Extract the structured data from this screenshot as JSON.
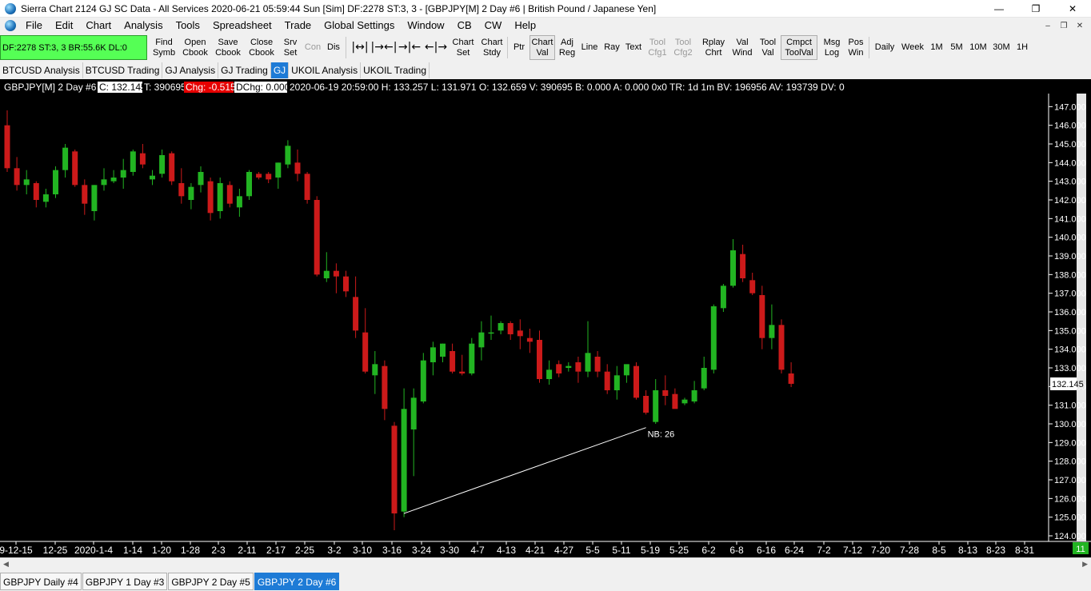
{
  "titlebar": {
    "title": "Sierra Chart 2124 GJ  SC Data - All Services 2020-06-21  05:59:44 Sun [Sim]  DF:2278  ST:3, 3 - [GBPJPY[M]  2 Day   #6 | British Pound / Japanese Yen]",
    "minimize": "—",
    "restore": "❐",
    "close": "✕"
  },
  "menubar": {
    "items": [
      "File",
      "Edit",
      "Chart",
      "Analysis",
      "Tools",
      "Spreadsheet",
      "Trade",
      "Global Settings",
      "Window",
      "CB",
      "CW",
      "Help"
    ],
    "mdi_minimize": "–",
    "mdi_restore": "❐",
    "mdi_close": "✕"
  },
  "toolbar": {
    "status": "DF:2278  ST:3, 3  BR:55.6K  DL:0",
    "buttons": {
      "find": [
        "Find",
        "Symb"
      ],
      "open": [
        "Open",
        "Cbook"
      ],
      "save": [
        "Save",
        "Cbook"
      ],
      "closecb": [
        "Close",
        "Cbook"
      ],
      "srv": [
        "Srv",
        "Set"
      ],
      "con": "Con",
      "dis": "Dis",
      "chart_set": [
        "Chart",
        "Set"
      ],
      "chart_stdy": [
        "Chart",
        "Stdy"
      ],
      "ptr": "Ptr",
      "chart_val": [
        "Chart",
        "Val"
      ],
      "adj_reg": [
        "Adj",
        "Reg"
      ],
      "line": "Line",
      "ray": "Ray",
      "text": "Text",
      "tool_cfg1": [
        "Tool",
        "Cfg1"
      ],
      "tool_cfg2": [
        "Tool",
        "Cfg2"
      ],
      "rplay": [
        "Rplay",
        "Chrt"
      ],
      "val_wind": [
        "Val",
        "Wind"
      ],
      "tool_val": [
        "Tool",
        "Val"
      ],
      "cmpct": [
        "Cmpct",
        "ToolVal"
      ],
      "msg_log": [
        "Msg",
        "Log"
      ],
      "pos_win": [
        "Pos",
        "Win"
      ],
      "daily": "Daily",
      "week": "Week",
      "tf_1m": "1M",
      "tf_5m": "5M",
      "tf_10m": "10M",
      "tf_30m": "30M",
      "tf_1h": "1H"
    }
  },
  "workspace_tabs": [
    "BTCUSD Analysis",
    "BTCUSD Trading",
    "GJ Analysis",
    "GJ Trading",
    "GJ",
    "UKOIL Analysis",
    "UKOIL Trading"
  ],
  "workspace_active": "GJ",
  "chart_header": {
    "symbol": "GBPJPY[M]  2 Day   #6",
    "close": "C: 132.145",
    "trades": "T: 390695",
    "chg": "Chg: -0.515",
    "dchg": "DChg: 0.000",
    "details": "2020-06-19 20:59:00  H: 133.257  L: 131.971  O: 132.659  V: 390695  B: 0.000  A: 0.000  0x0  TR: 1d 1m  BV: 196956  AV: 193739  DV: 0"
  },
  "bottom_tabs": [
    "GBPJPY  Daily  #4",
    "GBPJPY  1 Day  #3",
    "GBPJPY  2 Day  #5",
    "GBPJPY  2 Day  #6"
  ],
  "bottom_active": 3,
  "chart_data": {
    "type": "candlestick",
    "y_range": [
      123.7,
      147.7
    ],
    "y_ticks": [
      124,
      125,
      126,
      127,
      128,
      129,
      130,
      131,
      132,
      133,
      134,
      135,
      136,
      137,
      138,
      139,
      140,
      141,
      142,
      143,
      144,
      145,
      146,
      147
    ],
    "last_price_label": "132.145",
    "last_price": 132.145,
    "x_labels": [
      "9-12-15",
      "12-25",
      "2020-1-4",
      "1-14",
      "1-20",
      "1-28",
      "2-3",
      "2-11",
      "2-17",
      "2-25",
      "3-2",
      "3-10",
      "3-16",
      "3-24",
      "3-30",
      "4-7",
      "4-13",
      "4-21",
      "4-27",
      "5-5",
      "5-11",
      "5-19",
      "5-25",
      "6-2",
      "6-8",
      "6-16",
      "6-24",
      "7-2",
      "7-12",
      "7-20",
      "7-28",
      "8-5",
      "8-13",
      "8-23",
      "8-31"
    ],
    "corner_label": "11",
    "annotation": {
      "text": "NB: 26",
      "from_bar": 41,
      "from_price": 125.2,
      "to_bar": 66,
      "to_price": 129.8
    },
    "colors": {
      "up": "#22b422",
      "down": "#cc1a1a",
      "background": "#000000",
      "axis_text": "#ffffff"
    },
    "candles": [
      [
        146.0,
        146.8,
        143.5,
        143.7
      ],
      [
        143.7,
        144.3,
        142.5,
        142.8
      ],
      [
        142.8,
        143.6,
        142.3,
        143.1
      ],
      [
        142.9,
        143.0,
        141.6,
        142.0
      ],
      [
        141.9,
        142.6,
        141.6,
        142.3
      ],
      [
        142.3,
        143.8,
        142.1,
        143.6
      ],
      [
        143.6,
        145.0,
        143.2,
        144.8
      ],
      [
        144.6,
        144.7,
        142.7,
        142.8
      ],
      [
        142.8,
        143.1,
        141.2,
        141.8
      ],
      [
        141.4,
        142.8,
        140.9,
        142.8
      ],
      [
        142.8,
        143.7,
        142.5,
        143.1
      ],
      [
        143.0,
        143.6,
        142.9,
        143.2
      ],
      [
        143.2,
        144.2,
        142.6,
        143.6
      ],
      [
        143.5,
        144.7,
        143.3,
        144.6
      ],
      [
        144.5,
        145.0,
        143.7,
        143.9
      ],
      [
        143.1,
        143.6,
        142.8,
        143.3
      ],
      [
        143.4,
        144.7,
        143.2,
        144.4
      ],
      [
        144.5,
        144.6,
        142.8,
        143.0
      ],
      [
        142.9,
        143.7,
        141.8,
        142.2
      ],
      [
        142.0,
        142.9,
        141.5,
        142.7
      ],
      [
        142.8,
        143.8,
        142.4,
        143.5
      ],
      [
        143.0,
        143.2,
        140.9,
        141.3
      ],
      [
        141.4,
        143.2,
        141.0,
        142.9
      ],
      [
        142.8,
        143.0,
        141.6,
        141.8
      ],
      [
        141.6,
        142.6,
        141.1,
        142.2
      ],
      [
        142.2,
        143.6,
        142.0,
        143.5
      ],
      [
        143.4,
        143.5,
        143.1,
        143.2
      ],
      [
        143.4,
        143.5,
        142.9,
        143.1
      ],
      [
        143.2,
        144.0,
        142.6,
        144.0
      ],
      [
        143.9,
        145.2,
        143.7,
        144.9
      ],
      [
        144.0,
        144.7,
        143.0,
        143.4
      ],
      [
        143.4,
        143.5,
        141.8,
        142.0
      ],
      [
        142.0,
        142.2,
        137.9,
        138.0
      ],
      [
        137.8,
        139.2,
        137.6,
        138.2
      ],
      [
        138.2,
        138.6,
        137.0,
        137.9
      ],
      [
        137.9,
        138.2,
        136.8,
        137.1
      ],
      [
        136.8,
        137.9,
        134.6,
        135.0
      ],
      [
        134.9,
        136.2,
        132.7,
        132.8
      ],
      [
        132.6,
        133.9,
        131.6,
        133.2
      ],
      [
        133.1,
        133.4,
        130.2,
        130.8
      ],
      [
        129.9,
        130.1,
        124.3,
        125.2
      ],
      [
        125.3,
        131.9,
        125.0,
        130.8
      ],
      [
        129.7,
        131.9,
        127.2,
        131.4
      ],
      [
        131.2,
        133.8,
        131.1,
        133.4
      ],
      [
        133.3,
        134.4,
        132.6,
        134.1
      ],
      [
        133.6,
        134.3,
        133.3,
        134.3
      ],
      [
        133.9,
        134.3,
        132.7,
        132.8
      ],
      [
        132.8,
        133.7,
        132.6,
        132.7
      ],
      [
        132.7,
        134.6,
        132.6,
        134.3
      ],
      [
        134.1,
        135.5,
        133.4,
        134.9
      ],
      [
        134.9,
        135.8,
        134.5,
        134.9
      ],
      [
        135.0,
        135.5,
        134.8,
        135.4
      ],
      [
        135.4,
        135.5,
        134.5,
        134.8
      ],
      [
        135.0,
        135.6,
        134.0,
        134.7
      ],
      [
        134.6,
        135.1,
        133.8,
        134.4
      ],
      [
        134.5,
        135.0,
        132.2,
        132.4
      ],
      [
        132.4,
        133.4,
        132.1,
        132.9
      ],
      [
        133.2,
        133.4,
        132.5,
        132.7
      ],
      [
        133.0,
        133.3,
        132.8,
        133.1
      ],
      [
        133.3,
        133.6,
        132.2,
        132.8
      ],
      [
        132.8,
        135.5,
        132.5,
        133.8
      ],
      [
        133.6,
        133.9,
        132.5,
        132.8
      ],
      [
        132.8,
        133.2,
        131.6,
        131.8
      ],
      [
        131.8,
        133.1,
        131.3,
        132.6
      ],
      [
        132.6,
        133.1,
        132.2,
        133.2
      ],
      [
        133.1,
        133.3,
        131.3,
        131.4
      ],
      [
        131.5,
        131.8,
        130.5,
        130.6
      ],
      [
        130.1,
        132.4,
        130.0,
        131.8
      ],
      [
        131.8,
        132.6,
        131.0,
        131.5
      ],
      [
        131.6,
        131.9,
        131.2,
        130.8
      ],
      [
        131.1,
        131.4,
        131.0,
        131.3
      ],
      [
        131.2,
        132.3,
        131.1,
        131.8
      ],
      [
        131.9,
        133.6,
        131.8,
        133.0
      ],
      [
        132.9,
        136.4,
        132.7,
        136.3
      ],
      [
        136.2,
        137.5,
        136.0,
        137.4
      ],
      [
        137.4,
        139.9,
        137.3,
        139.3
      ],
      [
        139.1,
        139.6,
        137.6,
        137.8
      ],
      [
        137.7,
        138.1,
        136.9,
        137.0
      ],
      [
        136.9,
        137.4,
        134.0,
        134.6
      ],
      [
        134.6,
        136.4,
        134.0,
        135.3
      ],
      [
        135.3,
        135.6,
        132.7,
        132.9
      ],
      [
        132.7,
        133.3,
        131.97,
        132.145
      ]
    ]
  }
}
